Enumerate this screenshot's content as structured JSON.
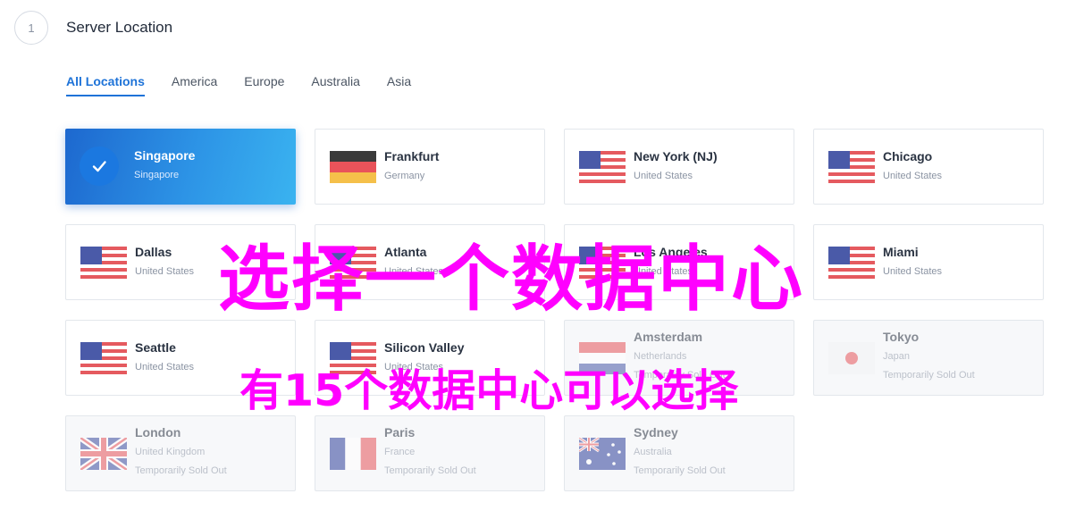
{
  "step": {
    "number": "1",
    "title": "Server Location"
  },
  "tabs": [
    {
      "label": "All Locations",
      "active": true
    },
    {
      "label": "America"
    },
    {
      "label": "Europe"
    },
    {
      "label": "Australia"
    },
    {
      "label": "Asia"
    }
  ],
  "locations": [
    {
      "name": "Singapore",
      "country": "Singapore",
      "flag": "singapore-flag-icon",
      "selected": true
    },
    {
      "name": "Frankfurt",
      "country": "Germany",
      "flag": "germany-flag-icon"
    },
    {
      "name": "New York (NJ)",
      "country": "United States",
      "flag": "us-flag-icon"
    },
    {
      "name": "Chicago",
      "country": "United States",
      "flag": "us-flag-icon"
    },
    {
      "name": "Dallas",
      "country": "United States",
      "flag": "us-flag-icon"
    },
    {
      "name": "Atlanta",
      "country": "United States",
      "flag": "us-flag-icon"
    },
    {
      "name": "Los Angeles",
      "country": "United States",
      "flag": "us-flag-icon"
    },
    {
      "name": "Miami",
      "country": "United States",
      "flag": "us-flag-icon"
    },
    {
      "name": "Seattle",
      "country": "United States",
      "flag": "us-flag-icon"
    },
    {
      "name": "Silicon Valley",
      "country": "United States",
      "flag": "us-flag-icon"
    },
    {
      "name": "Amsterdam",
      "country": "Netherlands",
      "status": "Temporarily Sold Out",
      "flag": "netherlands-flag-icon",
      "sold_out": true
    },
    {
      "name": "Tokyo",
      "country": "Japan",
      "status": "Temporarily Sold Out",
      "flag": "japan-flag-icon",
      "sold_out": true
    },
    {
      "name": "London",
      "country": "United Kingdom",
      "status": "Temporarily Sold Out",
      "flag": "uk-flag-icon",
      "sold_out": true
    },
    {
      "name": "Paris",
      "country": "France",
      "status": "Temporarily Sold Out",
      "flag": "france-flag-icon",
      "sold_out": true
    },
    {
      "name": "Sydney",
      "country": "Australia",
      "status": "Temporarily Sold Out",
      "flag": "australia-flag-icon",
      "sold_out": true
    }
  ],
  "overlays": {
    "headline": "选择一个数据中心",
    "subline": "有15个数据中心可以选择"
  },
  "colors": {
    "accent": "#1e73d8",
    "selected_gradient_start": "#1d68cf",
    "selected_gradient_end": "#3ab3f0",
    "overlay_text": "#ff00ff"
  }
}
